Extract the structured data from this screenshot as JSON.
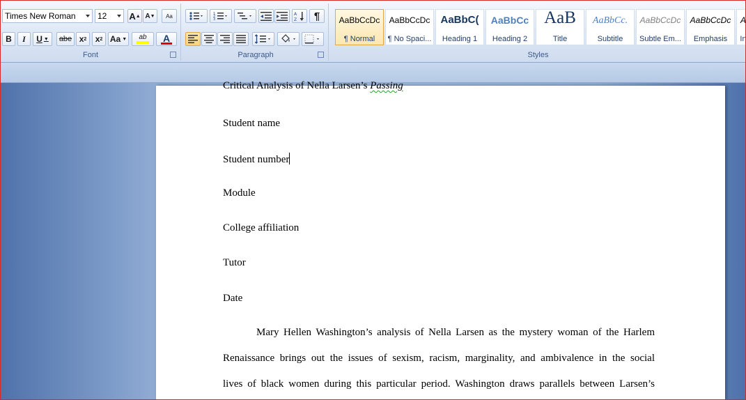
{
  "font_group": {
    "label": "Font",
    "font_name": "Times New Roman",
    "font_size": "12",
    "grow": "A",
    "shrink": "A",
    "clear_format": "Aa",
    "bold": "B",
    "italic": "I",
    "underline": "U",
    "strikethrough": "abe",
    "subscript": "x",
    "superscript": "x",
    "change_case": "Aa",
    "highlight": "ab",
    "font_color": "A"
  },
  "paragraph_group": {
    "label": "Paragraph",
    "pilcrow": "¶"
  },
  "styles_group": {
    "label": "Styles",
    "tiles": [
      {
        "sample": "AaBbCcDc",
        "name": "¶ Normal"
      },
      {
        "sample": "AaBbCcDc",
        "name": "¶ No Spaci..."
      },
      {
        "sample": "AaBbC(",
        "name": "Heading 1"
      },
      {
        "sample": "AaBbCc",
        "name": "Heading 2"
      },
      {
        "sample": "AaB",
        "name": "Title"
      },
      {
        "sample": "AaBbCc.",
        "name": "Subtitle"
      },
      {
        "sample": "AaBbCcDc",
        "name": "Subtle Em..."
      },
      {
        "sample": "AaBbCcDc",
        "name": "Emphasis"
      },
      {
        "sample": "A",
        "name": "In"
      }
    ]
  },
  "document": {
    "title_prefix": "Critical Analysis of Nella Larsen’s ",
    "title_italic": "Passing",
    "fields": [
      "Student name",
      "Student number",
      "Module",
      "College affiliation",
      "Tutor",
      "Date"
    ],
    "body": [
      "Mary Hellen Washington’s analysis of Nella Larsen as the mystery woman of the Harlem",
      "Renaissance brings out the issues of sexism, racism, marginality, and ambivalence in the social",
      "lives of black women during this particular period. Washington draws parallels between Larsen’s"
    ]
  },
  "colors": {
    "highlight_yellow": "#ffff00",
    "font_color_red": "#e00000",
    "frame_red": "#d42a2a"
  }
}
